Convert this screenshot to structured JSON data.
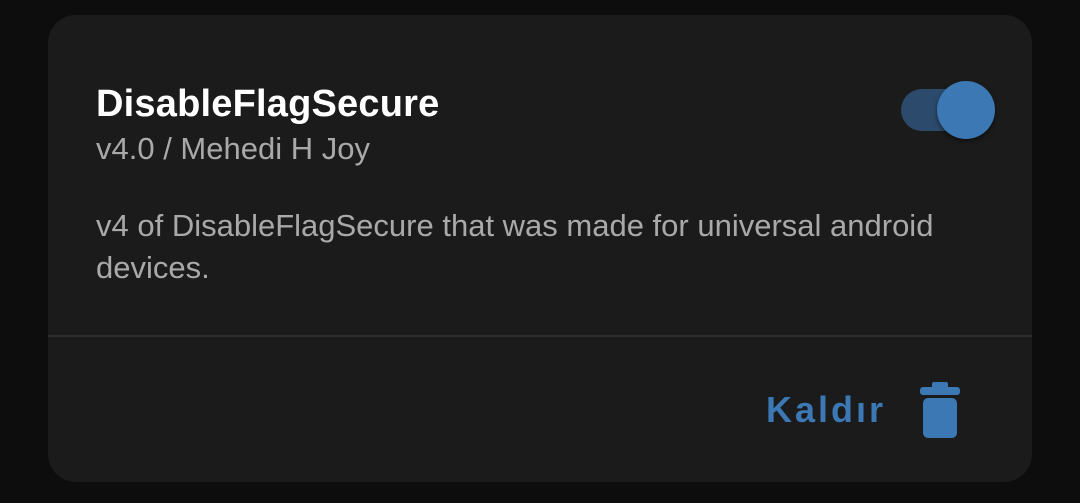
{
  "module": {
    "name": "DisableFlagSecure",
    "version_author": "v4.0 / Mehedi H Joy",
    "description": "v4 of DisableFlagSecure that was made for universal android devices.",
    "enabled": true
  },
  "actions": {
    "remove_label": "Kaldır",
    "remove_icon": "trash-icon"
  },
  "colors": {
    "accent": "#3c78b4",
    "toggle_track": "#2c4a6b",
    "card_background": "#1b1b1b",
    "page_background": "#0d0d0d"
  }
}
